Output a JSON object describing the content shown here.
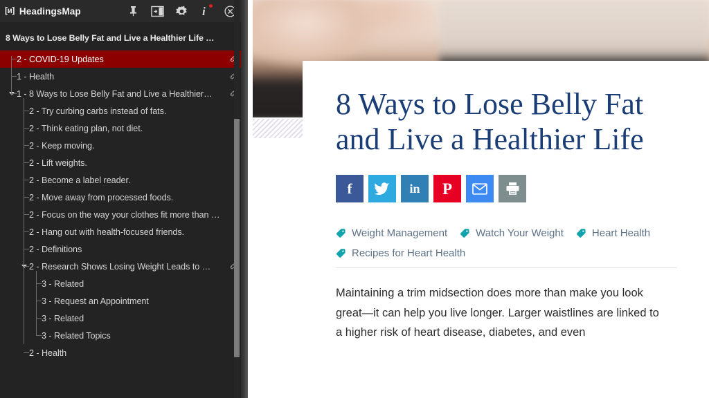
{
  "panel": {
    "brand": {
      "logo_glyph": "[ᴎ]",
      "name": "HeadingsMap"
    },
    "header_icons": [
      {
        "name": "pin-icon",
        "title": "Pin"
      },
      {
        "name": "panel-toggle-icon",
        "title": "Toggle panel"
      },
      {
        "name": "gear-icon",
        "title": "Settings"
      },
      {
        "name": "info-icon",
        "title": "Info",
        "badge": true
      },
      {
        "name": "close-icon",
        "title": "Close"
      }
    ],
    "document_title": "8 Ways to Lose Belly Fat and Live a Healthier Life …",
    "tree": [
      {
        "level": "2",
        "sep": "-",
        "text": "COVID-19 Updates",
        "indent": 1,
        "selected": true,
        "link": true,
        "caret": false
      },
      {
        "level": "1",
        "sep": "-",
        "text": "Health",
        "indent": 1,
        "selected": false,
        "link": true,
        "caret": false
      },
      {
        "level": "1",
        "sep": "-",
        "text": "8 Ways to Lose Belly Fat and Live a Healthier…",
        "indent": 1,
        "selected": false,
        "link": true,
        "caret": true
      },
      {
        "level": "2",
        "sep": "-",
        "text": "Try curbing carbs instead of fats.",
        "indent": 2,
        "selected": false,
        "link": false,
        "caret": false
      },
      {
        "level": "2",
        "sep": "-",
        "text": "Think eating plan, not diet.",
        "indent": 2,
        "selected": false,
        "link": false,
        "caret": false
      },
      {
        "level": "2",
        "sep": "-",
        "text": "Keep moving.",
        "indent": 2,
        "selected": false,
        "link": false,
        "caret": false
      },
      {
        "level": "2",
        "sep": "-",
        "text": "Lift weights.",
        "indent": 2,
        "selected": false,
        "link": false,
        "caret": false
      },
      {
        "level": "2",
        "sep": "-",
        "text": "Become a label reader.",
        "indent": 2,
        "selected": false,
        "link": false,
        "caret": false
      },
      {
        "level": "2",
        "sep": "-",
        "text": "Move away from processed foods.",
        "indent": 2,
        "selected": false,
        "link": false,
        "caret": false
      },
      {
        "level": "2",
        "sep": "-",
        "text": "Focus on the way your clothes fit more than …",
        "indent": 2,
        "selected": false,
        "link": false,
        "caret": false
      },
      {
        "level": "2",
        "sep": "-",
        "text": "Hang out with health-focused friends.",
        "indent": 2,
        "selected": false,
        "link": false,
        "caret": false
      },
      {
        "level": "2",
        "sep": "-",
        "text": " Definitions",
        "indent": 2,
        "selected": false,
        "link": false,
        "caret": false
      },
      {
        "level": "2",
        "sep": "-",
        "text": " Research Shows Losing Weight Leads to …",
        "indent": 2,
        "selected": false,
        "link": true,
        "caret": true
      },
      {
        "level": "3",
        "sep": "-",
        "text": "Related",
        "indent": 3,
        "selected": false,
        "link": false,
        "caret": false
      },
      {
        "level": "3",
        "sep": "-",
        "text": "Request an Appointment",
        "indent": 3,
        "selected": false,
        "link": false,
        "caret": false
      },
      {
        "level": "3",
        "sep": "-",
        "text": "Related",
        "indent": 3,
        "selected": false,
        "link": false,
        "caret": false
      },
      {
        "level": "3",
        "sep": "-",
        "text": "Related Topics",
        "indent": 3,
        "selected": false,
        "link": false,
        "caret": false
      },
      {
        "level": "2",
        "sep": "-",
        "text": "Health",
        "indent": 2,
        "selected": false,
        "link": false,
        "caret": false
      }
    ],
    "colors": {
      "background": "#232323",
      "header": "#2a2a2a",
      "selected_row": "#8c0000",
      "row_text": "#d6d6d6"
    }
  },
  "page": {
    "headline": "8 Ways to Lose Belly Fat and Live a Healthier Life",
    "headline_color": "#1b3d76",
    "share_buttons": [
      {
        "name": "share-facebook-button",
        "label": "f",
        "color": "#3b5998",
        "icon": "facebook-icon"
      },
      {
        "name": "share-twitter-button",
        "label": "",
        "color": "#2eaae1",
        "icon": "twitter-icon"
      },
      {
        "name": "share-linkedin-button",
        "label": "in",
        "color": "#3080b5",
        "icon": "linkedin-icon"
      },
      {
        "name": "share-pinterest-button",
        "label": "",
        "color": "#e60023",
        "icon": "pinterest-icon"
      },
      {
        "name": "share-email-button",
        "label": "",
        "color": "#3d8bf2",
        "icon": "envelope-icon"
      },
      {
        "name": "print-button",
        "label": "",
        "color": "#7e8d8d",
        "icon": "printer-icon"
      }
    ],
    "tags": [
      "Weight Management",
      "Watch Your Weight",
      "Heart Health",
      "Recipes for Heart Health"
    ],
    "tag_color": "#11a4ad",
    "body_text": "Maintaining a trim midsection does more than make you look great—it can help you live longer. Larger waistlines are linked to a higher risk of heart disease, diabetes, and even"
  }
}
